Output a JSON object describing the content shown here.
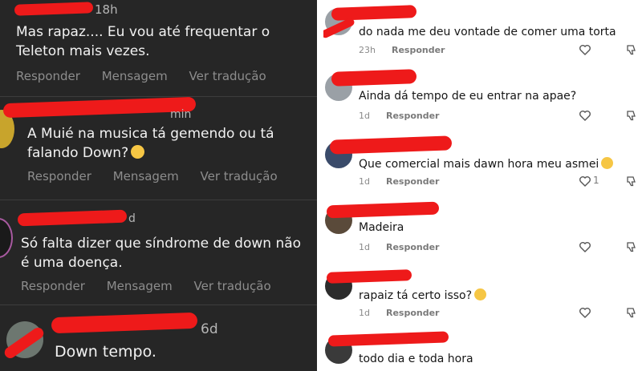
{
  "left_panel": {
    "actions": {
      "reply": "Responder",
      "message": "Mensagem",
      "translate": "Ver tradução"
    },
    "comments": [
      {
        "time": "18h",
        "text_line1": "Mas rapaz.... Eu vou até frequentar o",
        "text_line2": "Teleton mais vezes."
      },
      {
        "time": "min",
        "text_line1": "A Muié na musica tá gemendo ou tá",
        "text_line2": "falando Down?",
        "emoji": "thinking-face"
      },
      {
        "time": "d",
        "text_line1": "Só falta dizer que síndrome de down não",
        "text_line2": "é uma doença."
      },
      {
        "time": "6d",
        "text_line1": "Down tempo."
      }
    ]
  },
  "right_panel": {
    "reply_label": "Responder",
    "comments": [
      {
        "text": "do nada me deu vontade de comer uma torta",
        "time": "23h",
        "likes": ""
      },
      {
        "text": "Ainda dá tempo de eu entrar na apae?",
        "time": "1d",
        "likes": ""
      },
      {
        "text": "Que comercial mais dawn hora meu asmei",
        "time": "1d",
        "likes": "1",
        "emoji": "smiling-face-with-hearts"
      },
      {
        "text": "Madeira",
        "time": "1d",
        "likes": ""
      },
      {
        "text": "rapaiz tá certo isso?",
        "time": "1d",
        "likes": "",
        "emoji": "flushed-face"
      },
      {
        "text": "todo dia e toda hora",
        "time": "",
        "likes": ""
      }
    ]
  },
  "colors": {
    "redaction": "#ee1a1a",
    "dark_bg": "#262626",
    "light_bg": "#ffffff"
  }
}
